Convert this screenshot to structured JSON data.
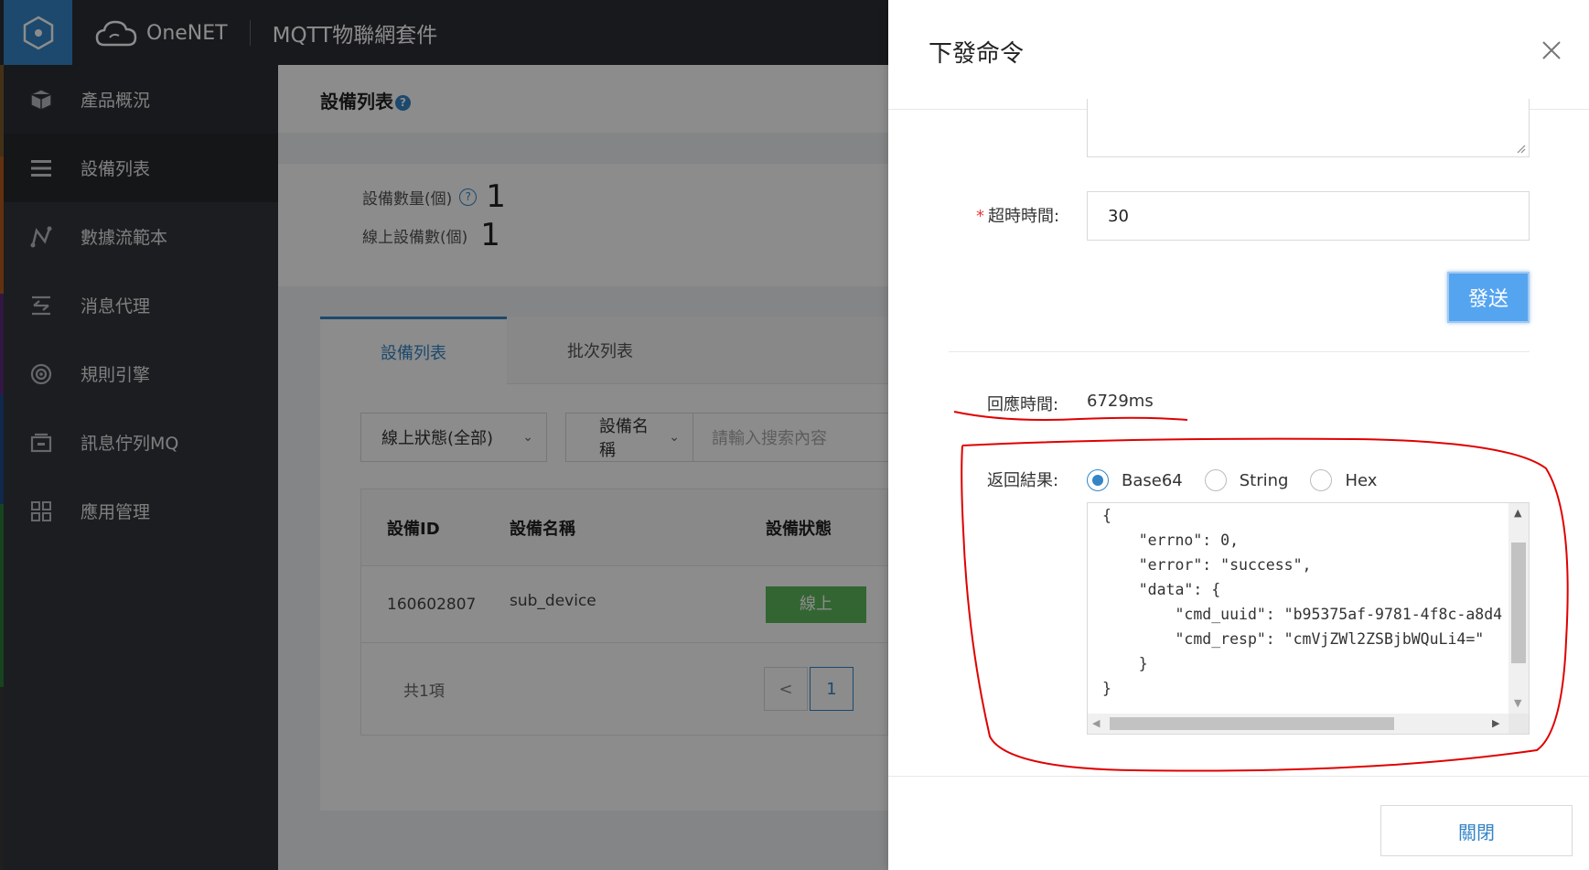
{
  "header": {
    "brand": "OneNET",
    "suite_title": "MQTT物聯網套件"
  },
  "sidebar": {
    "items": [
      {
        "label": "產品概況",
        "icon": "cube-icon"
      },
      {
        "label": "設備列表",
        "icon": "list-icon"
      },
      {
        "label": "數據流範本",
        "icon": "dataflow-icon"
      },
      {
        "label": "消息代理",
        "icon": "message-broker-icon"
      },
      {
        "label": "規則引擎",
        "icon": "rule-engine-icon"
      },
      {
        "label": "訊息佇列MQ",
        "icon": "queue-icon"
      },
      {
        "label": "應用管理",
        "icon": "grid-icon"
      }
    ]
  },
  "main": {
    "page_title": "設備列表",
    "help_mark": "?",
    "stats": {
      "device_count_label": "設備數量(個)",
      "device_count": "1",
      "online_count_label": "線上設備數(個)",
      "online_count": "1"
    },
    "tabs": [
      "設備列表",
      "批次列表"
    ],
    "filters": {
      "status_select": "線上狀態(全部)",
      "field_select": "設備名稱",
      "search_placeholder": "請輸入搜索內容"
    },
    "table": {
      "headers": [
        "設備ID",
        "設備名稱",
        "設備狀態"
      ],
      "rows": [
        {
          "id": "160602807",
          "name": "sub_device",
          "status": "線上"
        }
      ],
      "total": "共1項",
      "current_page": "1",
      "prev_symbol": "<"
    }
  },
  "drawer": {
    "title": "下發命令",
    "timeout_label": "超時時間:",
    "timeout_value": "30",
    "send_button": "發送",
    "response_time_label": "回應時間:",
    "response_time_value": "6729ms",
    "result_label": "返回結果:",
    "formats": [
      "Base64",
      "String",
      "Hex"
    ],
    "selected_format": "Base64",
    "result_text": "{\n    \"errno\": 0,\n    \"error\": \"success\",\n    \"data\": {\n        \"cmd_uuid\": \"b95375af-9781-4f8c-a8d4-\n        \"cmd_resp\": \"cmVjZWl2ZSBjbWQuLi4=\"\n    }\n}",
    "close_button": "關閉"
  },
  "colors": {
    "accent": "#3385c6",
    "send_button": "#55a4f0",
    "online_badge": "#5cb85c",
    "annotation": "#e00000"
  }
}
